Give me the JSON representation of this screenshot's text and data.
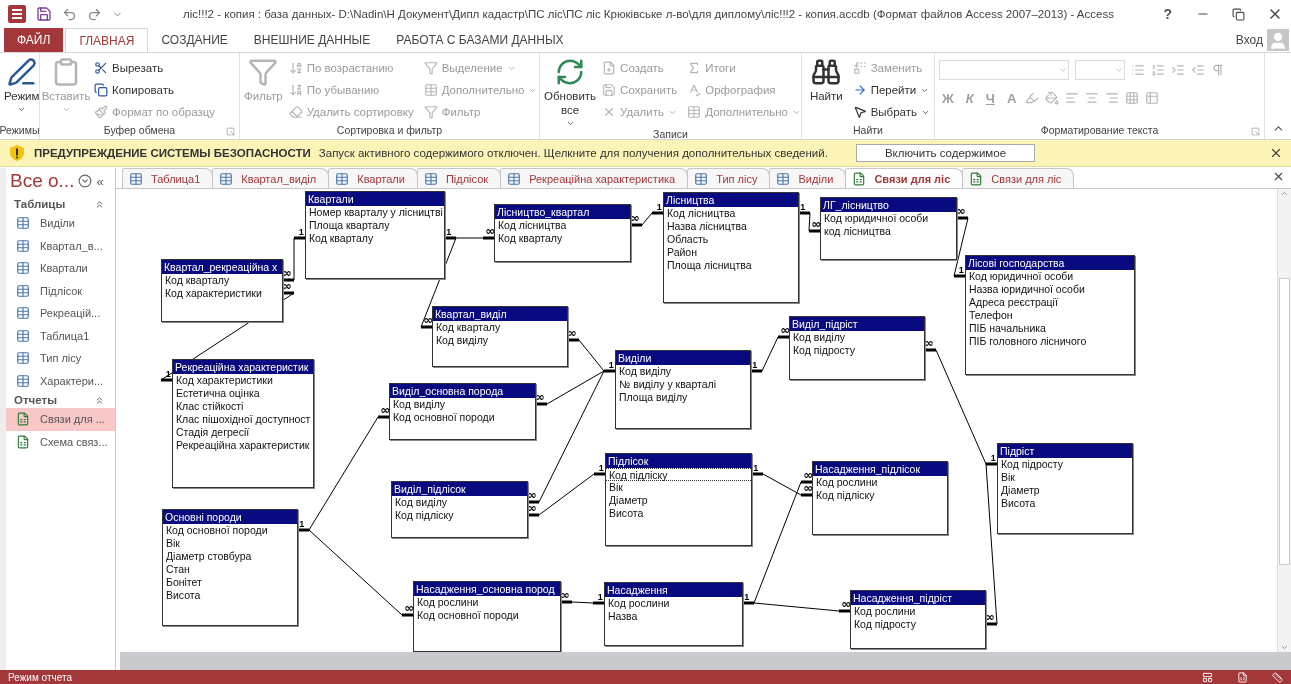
{
  "window": {
    "title": "ліс!!!2 - копия : база данных- D:\\Nadin\\Н Документ\\Дипл кадастр\\ПС ліс\\ПС ліс Крюківське л-во\\для диплому\\ліс!!!2 - копия.accdb (Формат файлов Access 2007–2013) - Access",
    "help": "?",
    "sign_in": "Вход"
  },
  "ribbon_tabs": [
    {
      "label": "ФАЙЛ",
      "kind": "file",
      "selected": false
    },
    {
      "label": "ГЛАВНАЯ",
      "kind": "tab",
      "selected": true
    },
    {
      "label": "СОЗДАНИЕ",
      "kind": "tab",
      "selected": false
    },
    {
      "label": "ВНЕШНИЕ ДАННЫЕ",
      "kind": "tab",
      "selected": false
    },
    {
      "label": "РАБОТА С БАЗАМИ ДАННЫХ",
      "kind": "tab",
      "selected": false
    }
  ],
  "ribbon_groups": [
    {
      "kind": "buttons",
      "label": "Режимы",
      "launcher": false,
      "items": [
        {
          "kind": "large",
          "label": "Режим",
          "disabled": false,
          "dropdown": true
        }
      ]
    },
    {
      "kind": "buttons",
      "label": "Буфер обмена",
      "launcher": true,
      "items": [
        {
          "kind": "large",
          "label": "Вставить",
          "disabled": true,
          "dropdown": true
        },
        {
          "kind": "small",
          "label": "Вырезать",
          "disabled": false,
          "dropdown": false
        },
        {
          "kind": "small",
          "label": "Копировать",
          "disabled": false,
          "dropdown": false
        },
        {
          "kind": "small",
          "label": "Формат по образцу",
          "disabled": true,
          "dropdown": false
        }
      ]
    },
    {
      "kind": "buttons",
      "label": "Сортировка и фильтр",
      "launcher": false,
      "items": [
        {
          "kind": "large",
          "label": "Фильтр",
          "disabled": true,
          "dropdown": false
        },
        {
          "kind": "small",
          "label": "По возрастанию",
          "disabled": true,
          "dropdown": false
        },
        {
          "kind": "small",
          "label": "По убыванию",
          "disabled": true,
          "dropdown": false
        },
        {
          "kind": "small",
          "label": "Удалить сортировку",
          "disabled": true,
          "dropdown": false
        },
        {
          "kind": "small",
          "label": "Выделение",
          "disabled": true,
          "dropdown": true
        },
        {
          "kind": "small",
          "label": "Дополнительно",
          "disabled": true,
          "dropdown": true
        },
        {
          "kind": "small",
          "label": "Фильтр",
          "disabled": true,
          "dropdown": false
        }
      ]
    },
    {
      "kind": "buttons",
      "label": "Записи",
      "launcher": false,
      "items": [
        {
          "kind": "large",
          "label": "Обновить все",
          "disabled": false,
          "dropdown": true
        },
        {
          "kind": "small",
          "label": "Создать",
          "disabled": true,
          "dropdown": false
        },
        {
          "kind": "small",
          "label": "Сохранить",
          "disabled": true,
          "dropdown": false
        },
        {
          "kind": "small",
          "label": "Удалить",
          "disabled": true,
          "dropdown": true
        },
        {
          "kind": "small",
          "label": "Итоги",
          "disabled": true,
          "dropdown": false
        },
        {
          "kind": "small",
          "label": "Орфография",
          "disabled": true,
          "dropdown": false
        },
        {
          "kind": "small",
          "label": "Дополнительно",
          "disabled": true,
          "dropdown": true
        }
      ]
    },
    {
      "kind": "buttons",
      "label": "Найти",
      "launcher": false,
      "items": [
        {
          "kind": "large",
          "label": "Найти",
          "disabled": false,
          "dropdown": false
        },
        {
          "kind": "small",
          "label": "Заменить",
          "disabled": true,
          "dropdown": false
        },
        {
          "kind": "small",
          "label": "Перейти",
          "disabled": false,
          "dropdown": true
        },
        {
          "kind": "small",
          "label": "Выбрать",
          "disabled": false,
          "dropdown": true
        }
      ]
    },
    {
      "kind": "format",
      "label": "Форматирование текста",
      "launcher": true,
      "disabled": true,
      "letters": [
        "Ж",
        "К",
        "Ч",
        "A"
      ]
    }
  ],
  "security_bar": {
    "title": "ПРЕДУПРЕЖДЕНИЕ СИСТЕМЫ БЕЗОПАСНОСТИ",
    "message": "Запуск активного содержимого отключен. Щелкните для получения дополнительных сведений.",
    "button": "Включить содержимое"
  },
  "document_tabs": [
    {
      "label": "Таблица1",
      "kind": "table",
      "selected": false
    },
    {
      "label": "Квартал_виділ",
      "kind": "table",
      "selected": false
    },
    {
      "label": "Квартали",
      "kind": "table",
      "selected": false
    },
    {
      "label": "Підлісок",
      "kind": "table",
      "selected": false
    },
    {
      "label": "Рекреаційна характеристика",
      "kind": "table",
      "selected": false
    },
    {
      "label": "Тип лісу",
      "kind": "table",
      "selected": false
    },
    {
      "label": "Виділи",
      "kind": "table",
      "selected": false
    },
    {
      "label": "Связи для ліс",
      "kind": "report",
      "selected": true
    },
    {
      "label": "Связи для ліс",
      "kind": "report",
      "selected": false
    }
  ],
  "sidebar": {
    "title": "Все о...",
    "collapse": "«",
    "sections": [
      {
        "label": "Таблицы",
        "expanded": true,
        "items": [
          {
            "label": "Виділи",
            "kind": "table",
            "selected": false
          },
          {
            "label": "Квартал_в...",
            "kind": "table",
            "selected": false
          },
          {
            "label": "Квартали",
            "kind": "table",
            "selected": false
          },
          {
            "label": "Підлісок",
            "kind": "table",
            "selected": false
          },
          {
            "label": "Рекреацій...",
            "kind": "table",
            "selected": false
          },
          {
            "label": "Таблица1",
            "kind": "table",
            "selected": false
          },
          {
            "label": "Тип лісу",
            "kind": "table",
            "selected": false
          },
          {
            "label": "Характери...",
            "kind": "table",
            "selected": false
          }
        ]
      },
      {
        "label": "Отчеты",
        "expanded": true,
        "items": [
          {
            "label": "Связи для ...",
            "kind": "report",
            "selected": true
          },
          {
            "label": "Схема связ...",
            "kind": "report",
            "selected": false
          }
        ]
      }
    ]
  },
  "diagram": {
    "tables": [
      {
        "title": "Квартали",
        "fields": [
          {
            "name": "Номер кварталу у лісництві",
            "selected": false
          },
          {
            "name": "Площа кварталу",
            "selected": false
          },
          {
            "name": "Код кварталу",
            "selected": false
          }
        ]
      },
      {
        "title": "Лісництво_квартал",
        "fields": [
          {
            "name": "Код лісництва",
            "selected": false
          },
          {
            "name": "Код кварталу",
            "selected": false
          }
        ]
      },
      {
        "title": "Лісництва",
        "fields": [
          {
            "name": "Код лісництва",
            "selected": false
          },
          {
            "name": "Назва лісництва",
            "selected": false
          },
          {
            "name": "Область",
            "selected": false
          },
          {
            "name": "Район",
            "selected": false
          },
          {
            "name": "Площа лісництва",
            "selected": false
          }
        ]
      },
      {
        "title": "ЛГ_лісництво",
        "fields": [
          {
            "name": "Код юридичної особи",
            "selected": false
          },
          {
            "name": "код лісництва",
            "selected": false
          }
        ]
      },
      {
        "title": "Квартал_рекреаційна х",
        "fields": [
          {
            "name": "Код кварталу",
            "selected": false
          },
          {
            "name": "Код характеристики",
            "selected": false
          }
        ]
      },
      {
        "title": "Квартал_виділ",
        "fields": [
          {
            "name": "Код кварталу",
            "selected": false
          },
          {
            "name": "Код виділу",
            "selected": false
          }
        ]
      },
      {
        "title": "Виділ_підріст",
        "fields": [
          {
            "name": "Код виділу",
            "selected": false
          },
          {
            "name": "Код підросту",
            "selected": false
          }
        ]
      },
      {
        "title": "Лісові господарства",
        "fields": [
          {
            "name": "Код юридичної особи",
            "selected": false
          },
          {
            "name": "Назва юридичної особи",
            "selected": false
          },
          {
            "name": "Адреса реєстрації",
            "selected": false
          },
          {
            "name": "Телефон",
            "selected": false
          },
          {
            "name": "ПІБ начальника",
            "selected": false
          },
          {
            "name": "ПІБ головного лісничого",
            "selected": false
          }
        ]
      },
      {
        "title": "Рекреаційна характеристик",
        "fields": [
          {
            "name": "Код характеристики",
            "selected": false
          },
          {
            "name": "Естетична оцінка",
            "selected": false
          },
          {
            "name": "Клас стійкості",
            "selected": false
          },
          {
            "name": "Клас пішохідної доступност",
            "selected": false
          },
          {
            "name": "Стадія дегресії",
            "selected": false
          },
          {
            "name": "Рекреаційна характеристик",
            "selected": false
          }
        ]
      },
      {
        "title": "Виділ_основна порода",
        "fields": [
          {
            "name": "Код виділу",
            "selected": false
          },
          {
            "name": "Код основної породи",
            "selected": false
          }
        ]
      },
      {
        "title": "Виділи",
        "fields": [
          {
            "name": "Код виділу",
            "selected": false
          },
          {
            "name": "№ виділу у кварталі",
            "selected": false
          },
          {
            "name": "Площа виділу",
            "selected": false
          }
        ]
      },
      {
        "title": "Виділ_підлісок",
        "fields": [
          {
            "name": "Код виділу",
            "selected": false
          },
          {
            "name": "Код підліску",
            "selected": false
          }
        ]
      },
      {
        "title": "Підлісок",
        "fields": [
          {
            "name": "Код підліску",
            "selected": true
          },
          {
            "name": "Вік",
            "selected": false
          },
          {
            "name": "Діаметр",
            "selected": false
          },
          {
            "name": "Висота",
            "selected": false
          }
        ]
      },
      {
        "title": "Насадження_підлісок",
        "fields": [
          {
            "name": "Код рослини",
            "selected": false
          },
          {
            "name": "Код підліску",
            "selected": false
          }
        ]
      },
      {
        "title": "Підріст",
        "fields": [
          {
            "name": "Код підросту",
            "selected": false
          },
          {
            "name": "Вік",
            "selected": false
          },
          {
            "name": "Діаметр",
            "selected": false
          },
          {
            "name": "Висота",
            "selected": false
          }
        ]
      },
      {
        "title": "Основні породи",
        "fields": [
          {
            "name": "Код основної породи",
            "selected": false
          },
          {
            "name": "Вік",
            "selected": false
          },
          {
            "name": "Діаметр стовбура",
            "selected": false
          },
          {
            "name": "Стан",
            "selected": false
          },
          {
            "name": "Бонітет",
            "selected": false
          },
          {
            "name": "Висота",
            "selected": false
          }
        ]
      },
      {
        "title": "Насадження_основна пород",
        "fields": [
          {
            "name": "Код рослини",
            "selected": false
          },
          {
            "name": "Код основної породи",
            "selected": false
          }
        ]
      },
      {
        "title": "Насадження",
        "fields": [
          {
            "name": "Код рослини",
            "selected": false
          },
          {
            "name": "Назва",
            "selected": false
          }
        ]
      },
      {
        "title": "Насадження_підріст",
        "fields": [
          {
            "name": "Код рослини",
            "selected": false
          },
          {
            "name": "Код підросту",
            "selected": false
          }
        ]
      }
    ],
    "relationships": [
      {
        "one_end": "1",
        "links": [
          {
            "many_end": "∞"
          }
        ]
      },
      {
        "one_end": "1",
        "links": [
          {
            "many_end": "∞"
          }
        ]
      },
      {
        "one_end": "1",
        "links": [
          {
            "many_end": "∞"
          }
        ]
      },
      {
        "one_end": "1",
        "links": [
          {
            "many_end": "∞"
          },
          {
            "many_end": "∞"
          }
        ]
      },
      {
        "one_end": "1",
        "links": [
          {
            "many_end": "∞"
          }
        ]
      },
      {
        "one_end": "1",
        "links": [
          {
            "many_end": "∞"
          }
        ]
      },
      {
        "one_end": "1",
        "links": [
          {
            "many_end": "∞"
          },
          {
            "many_end": "∞"
          },
          {
            "many_end": "∞"
          }
        ]
      },
      {
        "one_end": "1",
        "links": [
          {
            "many_end": "∞"
          }
        ]
      },
      {
        "one_end": "1",
        "links": [
          {
            "many_end": "∞"
          }
        ]
      },
      {
        "one_end": "1",
        "links": [
          {
            "many_end": "∞"
          }
        ]
      },
      {
        "one_end": "1",
        "links": [
          {
            "many_end": "∞"
          },
          {
            "many_end": "∞"
          }
        ]
      },
      {
        "one_end": "1",
        "links": [
          {
            "many_end": "∞"
          },
          {
            "many_end": "∞"
          }
        ]
      },
      {
        "one_end": "1",
        "links": [
          {
            "many_end": "∞"
          }
        ]
      },
      {
        "one_end": "1",
        "links": [
          {
            "many_end": "∞"
          },
          {
            "many_end": "∞"
          }
        ]
      }
    ]
  },
  "status_bar": {
    "text": "Режим отчета"
  }
}
